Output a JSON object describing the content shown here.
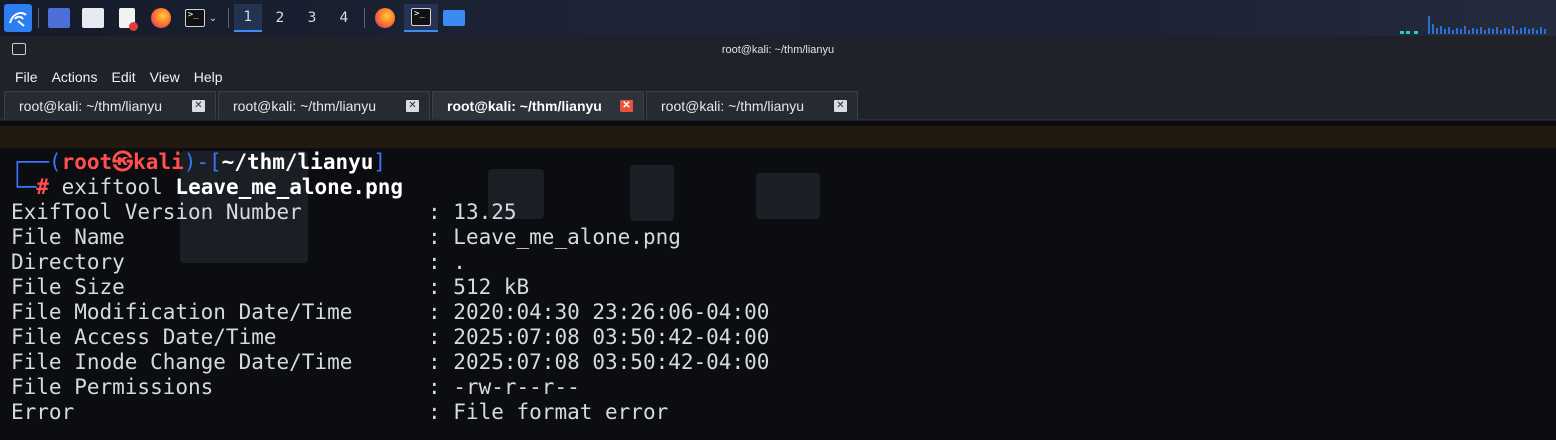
{
  "taskbar": {
    "workspaces": [
      "1",
      "2",
      "3",
      "4"
    ],
    "active_workspace": "1",
    "accent": "#3a8df5"
  },
  "window": {
    "title": "root@kali: ~/thm/lianyu",
    "menu": [
      "File",
      "Actions",
      "Edit",
      "View",
      "Help"
    ],
    "tabs": [
      {
        "label": "root@kali: ~/thm/lianyu",
        "active": false
      },
      {
        "label": "root@kali: ~/thm/lianyu",
        "active": false
      },
      {
        "label": "root@kali: ~/thm/lianyu",
        "active": true
      },
      {
        "label": "root@kali: ~/thm/lianyu",
        "active": false
      }
    ]
  },
  "terminal": {
    "prompt": {
      "open": "┌──(",
      "user": "root",
      "skull": "㉿",
      "host": "kali",
      "mid": ")-[",
      "path": "~/thm/lianyu",
      "close": "]",
      "corner": "└─",
      "hash": "#",
      "command": "exiftool",
      "argument": "Leave_me_alone.png"
    },
    "output": [
      {
        "key": "ExifTool Version Number",
        "value": "13.25"
      },
      {
        "key": "File Name",
        "value": "Leave_me_alone.png"
      },
      {
        "key": "Directory",
        "value": "."
      },
      {
        "key": "File Size",
        "value": "512 kB"
      },
      {
        "key": "File Modification Date/Time",
        "value": "2020:04:30 23:26:06-04:00"
      },
      {
        "key": "File Access Date/Time",
        "value": "2025:07:08 03:50:42-04:00"
      },
      {
        "key": "File Inode Change Date/Time",
        "value": "2025:07:08 03:50:42-04:00"
      },
      {
        "key": "File Permissions",
        "value": "-rw-r--r--"
      },
      {
        "key": "Error",
        "value": "File format error"
      }
    ],
    "colors": {
      "prompt_blue": "#3b73ff",
      "prompt_red": "#ff4f4f",
      "text": "#d6d9de"
    }
  }
}
